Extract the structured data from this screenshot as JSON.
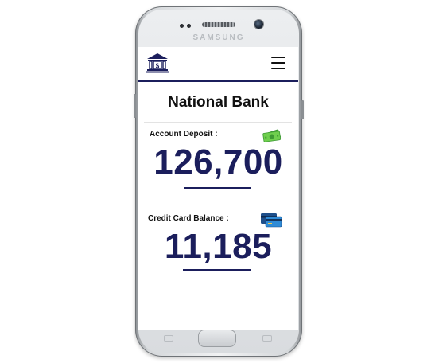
{
  "device": {
    "brand": "SAMSUNG"
  },
  "app": {
    "logo_icon": "bank-building-icon",
    "menu_icon": "hamburger-menu-icon",
    "title": "National Bank",
    "accent_color": "#1b1e5c"
  },
  "deposit": {
    "label": "Account Deposit :",
    "amount": "126,700",
    "icon": "cash-money-icon"
  },
  "credit": {
    "label": "Credit Card Balance :",
    "amount": "11,185",
    "icon": "credit-card-icon"
  }
}
